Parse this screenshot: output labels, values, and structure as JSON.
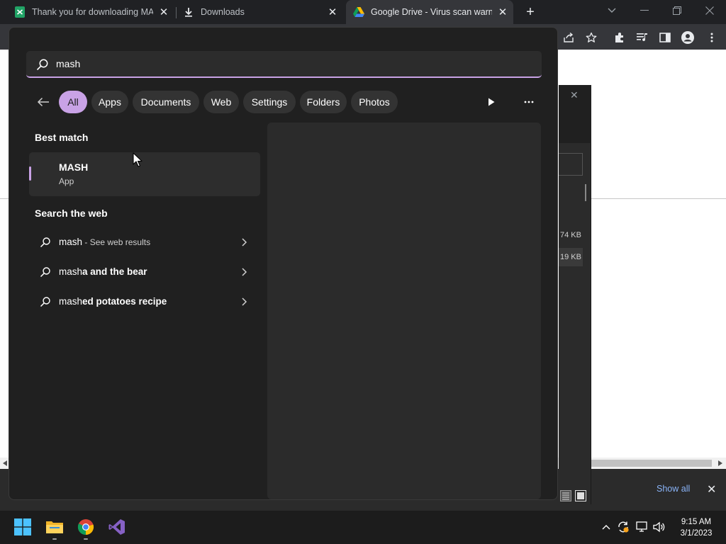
{
  "browser": {
    "tabs": [
      {
        "title": "Thank you for downloading MAS",
        "icon": "sheets-icon",
        "active": false
      },
      {
        "title": "Downloads",
        "icon": "download-icon",
        "active": false
      },
      {
        "title": "Google Drive - Virus scan warnin",
        "icon": "google-drive-icon",
        "active": true
      }
    ],
    "colors": {
      "tab_strip": "#202124",
      "toolbar": "#35363a"
    }
  },
  "page_background": {
    "download_sizes": [
      "74 KB",
      "19 KB"
    ],
    "show_all_label": "Show all"
  },
  "start_search": {
    "query": "mash",
    "filters": [
      "All",
      "Apps",
      "Documents",
      "Web",
      "Settings",
      "Folders",
      "Photos"
    ],
    "active_filter": "All",
    "best_match_heading": "Best match",
    "best_match": {
      "name": "MASH",
      "kind": "App"
    },
    "search_web_heading": "Search the web",
    "web_results": [
      {
        "typed": "mash",
        "rest": "",
        "hint": "See web results"
      },
      {
        "typed": "mash",
        "rest": "a and the bear",
        "hint": ""
      },
      {
        "typed": "mash",
        "rest": "ed potatoes recipe",
        "hint": ""
      }
    ],
    "accent_color": "#c9a2e6"
  },
  "taskbar": {
    "apps": [
      "windows-start-icon",
      "file-explorer-icon",
      "chrome-icon",
      "visual-studio-icon"
    ],
    "clock": {
      "time": "9:15 AM",
      "date": "3/1/2023"
    }
  }
}
